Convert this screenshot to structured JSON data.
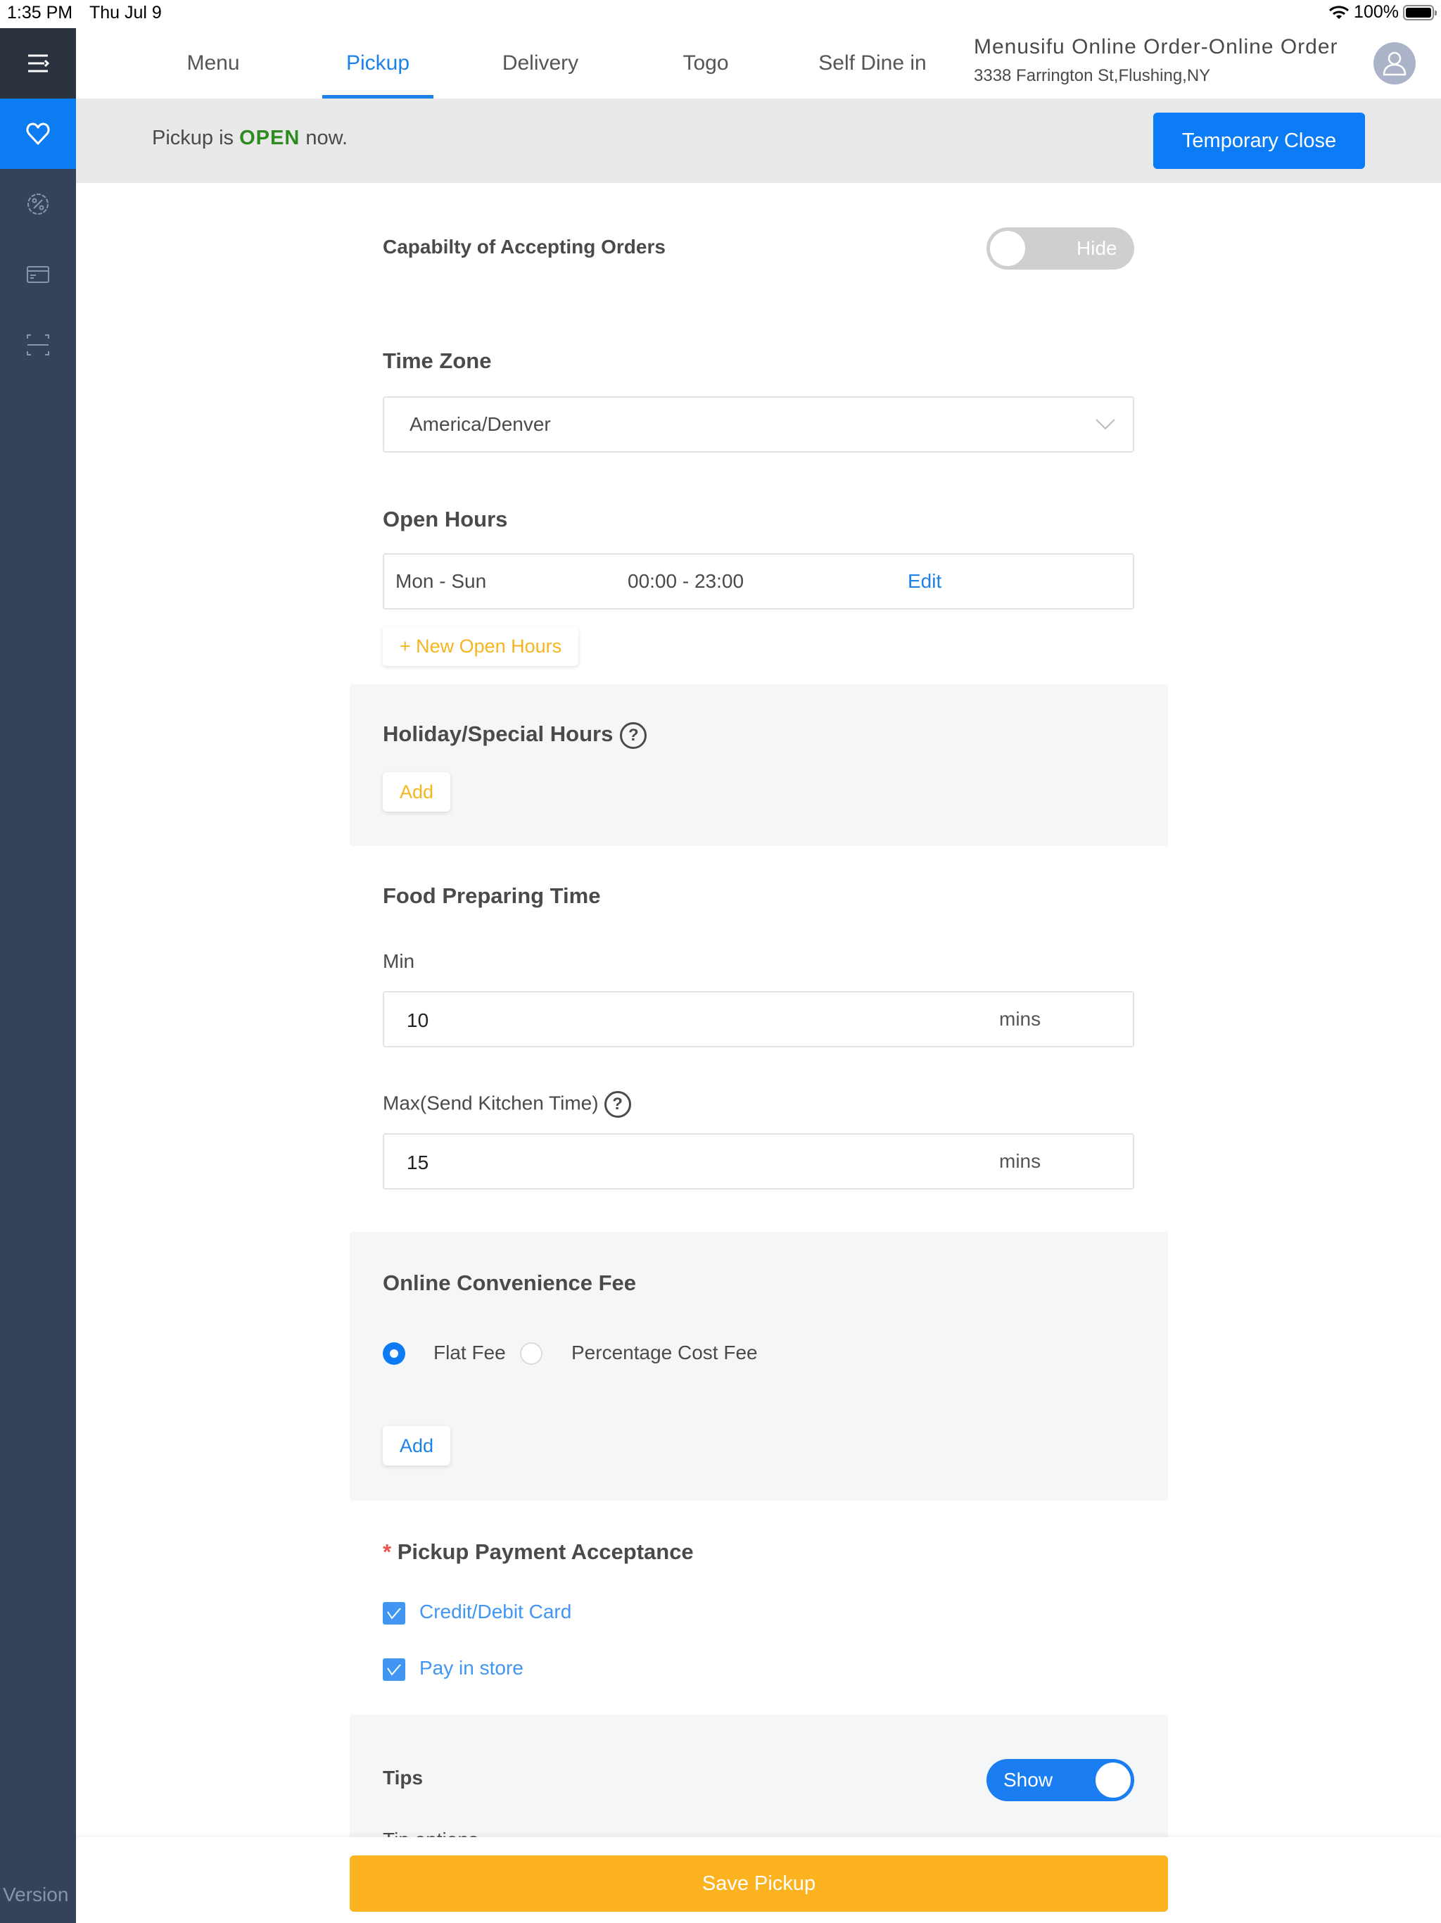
{
  "status_bar": {
    "time": "1:35 PM",
    "date": "Thu Jul 9",
    "battery": "100%",
    "battery_level_percent": 100
  },
  "sidebar": {
    "items": [
      {
        "icon": "heart-icon",
        "active": true
      },
      {
        "icon": "discount-badge-icon",
        "active": false
      },
      {
        "icon": "card-icon",
        "active": false
      },
      {
        "icon": "scan-icon",
        "active": false
      }
    ],
    "version_label": "Version"
  },
  "header": {
    "tabs": [
      {
        "label": "Menu",
        "active": false
      },
      {
        "label": "Pickup",
        "active": true
      },
      {
        "label": "Delivery",
        "active": false
      },
      {
        "label": "Togo",
        "active": false
      },
      {
        "label": "Self Dine in",
        "active": false
      }
    ],
    "store_name": "Menusifu Online Order-Online Order",
    "store_address": "3338 Farrington St,Flushing,NY"
  },
  "banner": {
    "prefix": "Pickup is",
    "status": "OPEN",
    "suffix": "now.",
    "button_label": "Temporary Close"
  },
  "form": {
    "accepting_orders": {
      "label": "Capabilty of Accepting Orders",
      "toggle_label": "Hide",
      "enabled": false
    },
    "time_zone": {
      "label": "Time Zone",
      "value": "America/Denver"
    },
    "open_hours": {
      "label": "Open Hours",
      "rows": [
        {
          "days": "Mon - Sun",
          "hours": "00:00 - 23:00",
          "action": "Edit"
        }
      ],
      "add_label": "+ New Open Hours"
    },
    "holiday_hours": {
      "label": "Holiday/Special Hours",
      "help": "?",
      "add_label": "Add"
    },
    "food_preparing_time": {
      "label": "Food Preparing Time",
      "min_label": "Min",
      "min_value": "10",
      "max_label": "Max(Send Kitchen Time)",
      "max_help": "?",
      "max_value": "15",
      "unit": "mins"
    },
    "convenience_fee": {
      "label": "Online Convenience Fee",
      "options": [
        {
          "label": "Flat Fee",
          "selected": true
        },
        {
          "label": "Percentage Cost Fee",
          "selected": false
        }
      ],
      "add_label": "Add"
    },
    "payment_acceptance": {
      "required_mark": "*",
      "label": "Pickup Payment Acceptance",
      "options": [
        {
          "label": "Credit/Debit Card",
          "checked": true
        },
        {
          "label": "Pay in store",
          "checked": true
        }
      ]
    },
    "tips": {
      "label": "Tips",
      "toggle_label": "Show",
      "enabled": true,
      "partial_next_label": "Tip options"
    }
  },
  "footer": {
    "save_label": "Save Pickup"
  },
  "colors": {
    "accent_blue": "#0b7cf5",
    "open_green": "#2d8c1f",
    "save_yellow": "#fcb31f",
    "sidebar_bg": "#34435a",
    "required_red": "#e8554e"
  }
}
